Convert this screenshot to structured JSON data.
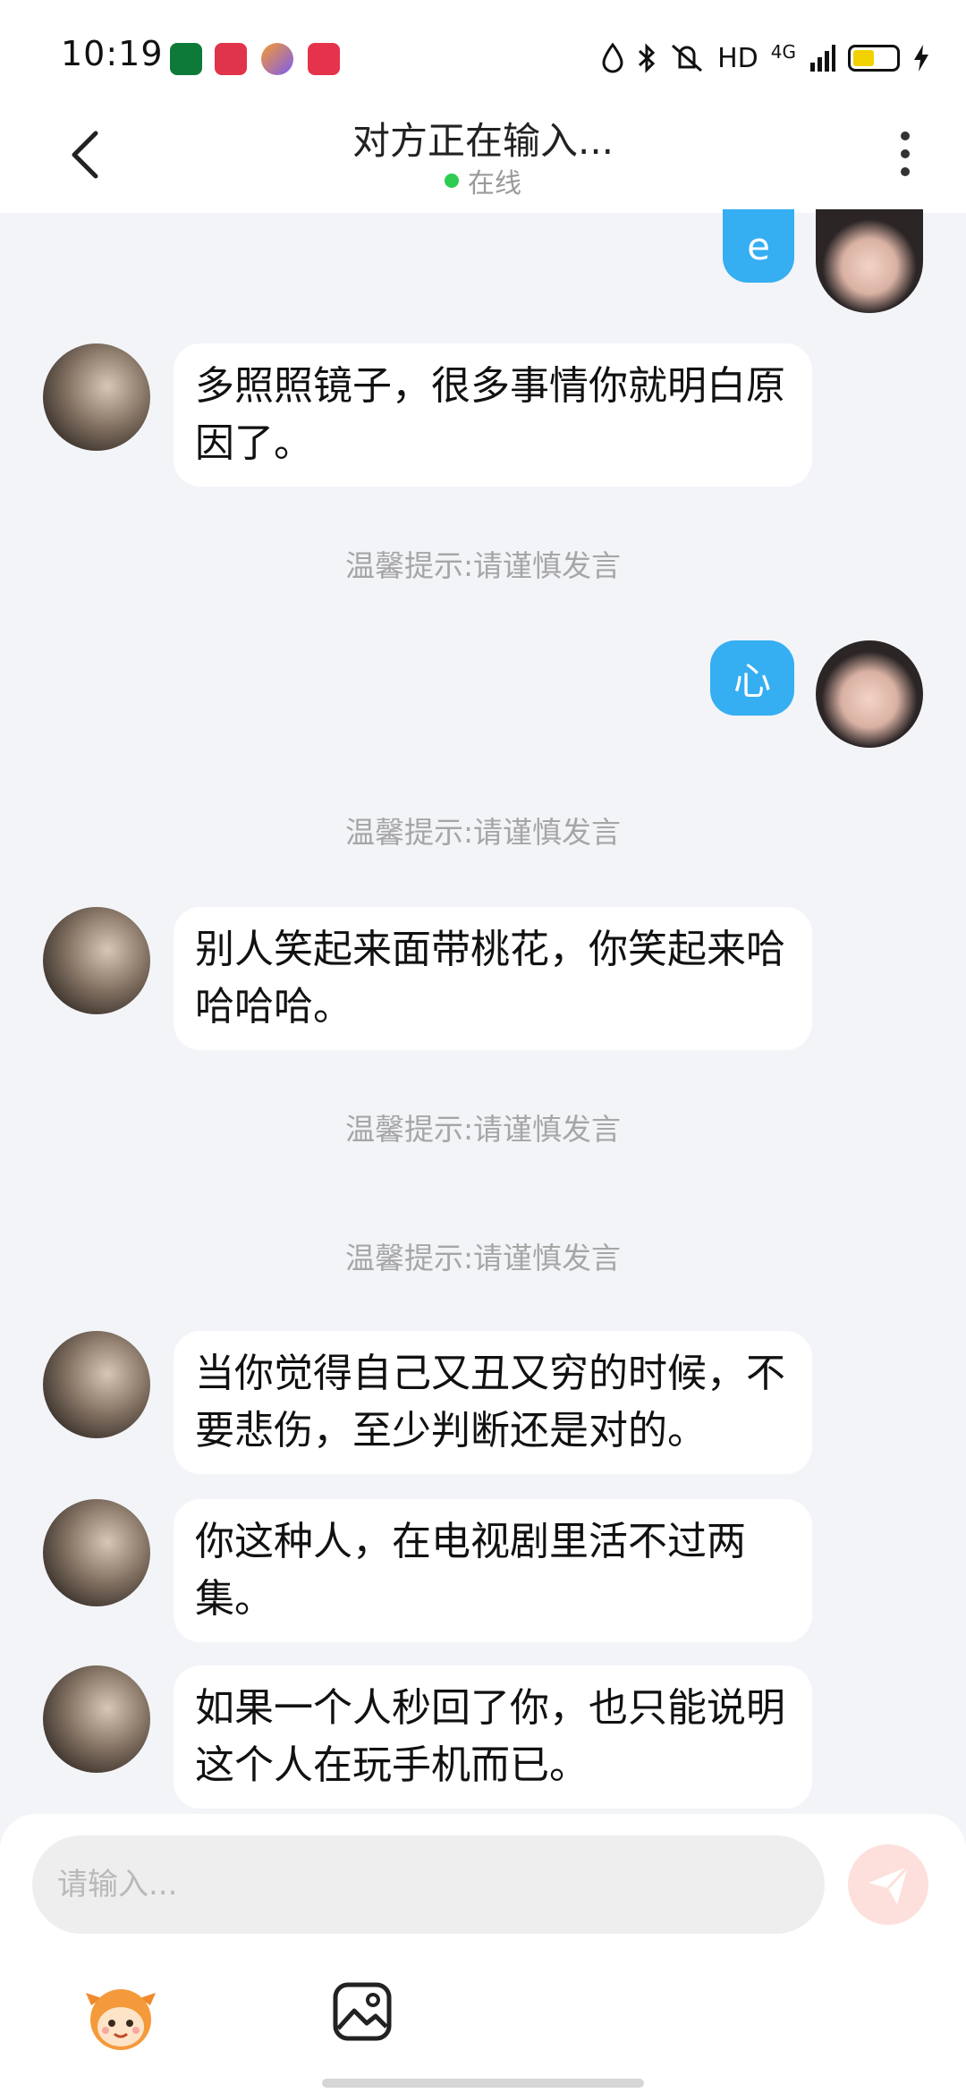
{
  "status_bar": {
    "time": "10:19",
    "hd": "HD",
    "net": "4G"
  },
  "header": {
    "title": "对方正在输入...",
    "online": "在线"
  },
  "messages": {
    "out1": "e",
    "in1": "多照照镜子，很多事情你就明白原因了。",
    "tip1": "温馨提示:请谨慎发言",
    "out2": "心",
    "tip2": "温馨提示:请谨慎发言",
    "in2": "别人笑起来面带桃花，你笑起来哈哈哈哈。",
    "tip3": "温馨提示:请谨慎发言",
    "tip4": "温馨提示:请谨慎发言",
    "in3": "当你觉得自己又丑又穷的时候，不要悲伤，至少判断还是对的。",
    "in4": "你这种人，在电视剧里活不过两集。",
    "in5": "如果一个人秒回了你，也只能说明这个人在玩手机而已。"
  },
  "input": {
    "placeholder": "请输入..."
  },
  "colors": {
    "accent": "#35aef2",
    "online": "#2ecc52",
    "send_disabled": "#fde0dc"
  }
}
